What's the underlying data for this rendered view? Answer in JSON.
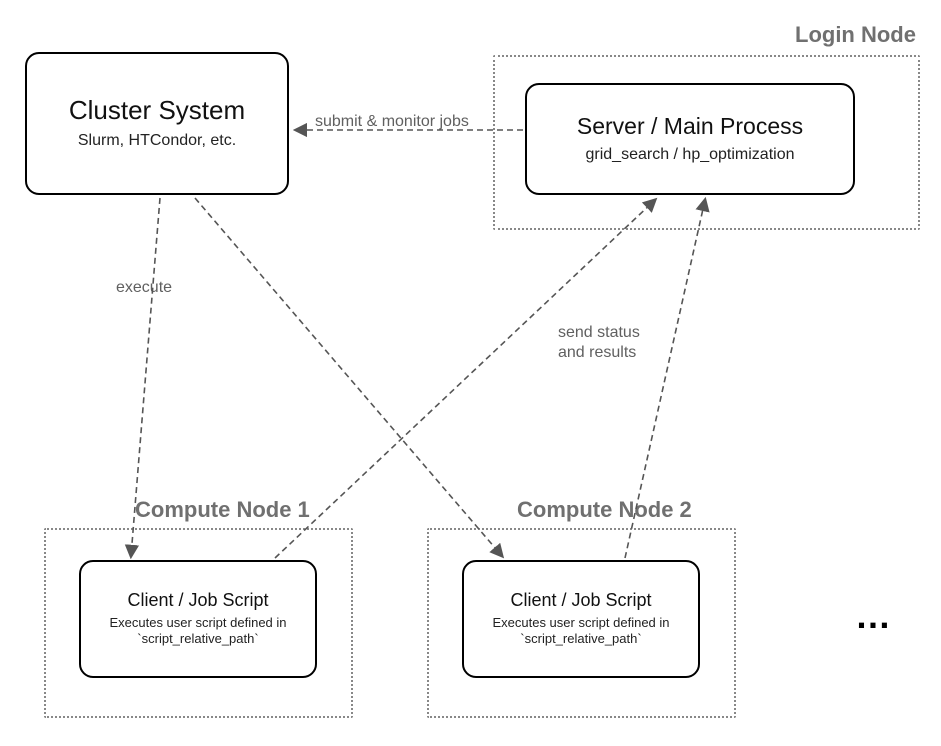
{
  "containers": {
    "login_node": {
      "label": "Login Node"
    },
    "compute1": {
      "label": "Compute Node 1"
    },
    "compute2": {
      "label": "Compute Node 2"
    }
  },
  "nodes": {
    "cluster": {
      "title": "Cluster System",
      "subtitle": "Slurm, HTCondor, etc."
    },
    "server": {
      "title": "Server / Main Process",
      "subtitle": "grid_search / hp_optimization"
    },
    "client1": {
      "title": "Client / Job Script",
      "subtitle": "Executes user script defined\nin `script_relative_path`"
    },
    "client2": {
      "title": "Client / Job Script",
      "subtitle": "Executes user script defined\nin `script_relative_path`"
    }
  },
  "edges": {
    "submit": "submit & monitor jobs",
    "execute": "execute",
    "status": "send status\nand results"
  },
  "ellipsis": "…"
}
